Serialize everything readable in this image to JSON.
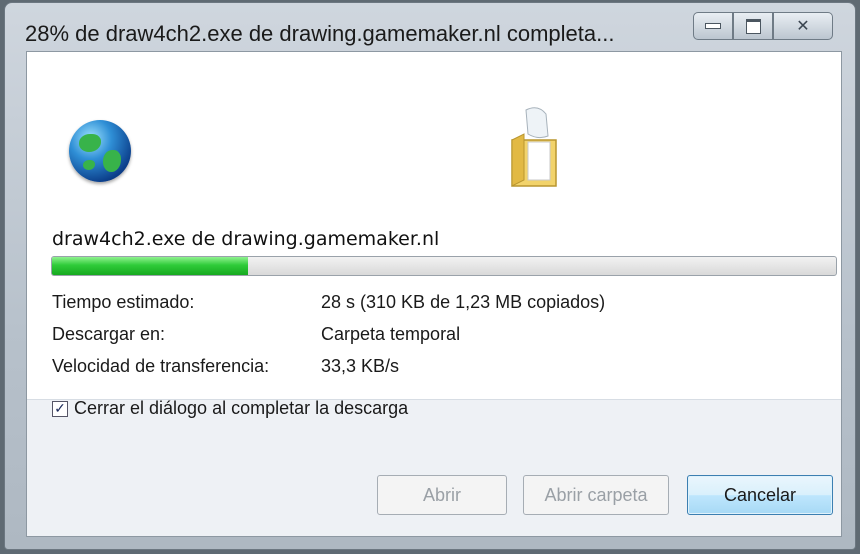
{
  "window": {
    "title": "28% de draw4ch2.exe de drawing.gamemaker.nl completa...",
    "controls": {
      "minimize_icon": "minimize-icon",
      "maximize_icon": "maximize-icon",
      "close_glyph": "✕"
    }
  },
  "download": {
    "file_line": "draw4ch2.exe de drawing.gamemaker.nl",
    "progress_fraction": 0.25
  },
  "details": {
    "time_label": "Tiempo estimado:",
    "time_value": "28 s (310 KB de 1,23 MB copiados)",
    "dest_label": "Descargar en:",
    "dest_value": "Carpeta temporal",
    "speed_label": "Velocidad de transferencia:",
    "speed_value": "33,3 KB/s"
  },
  "options": {
    "close_checkbox_checked": true,
    "check_glyph": "✓",
    "close_checkbox_label": "Cerrar el diálogo al completar la descarga"
  },
  "buttons": {
    "open": "Abrir",
    "open_folder": "Abrir carpeta",
    "cancel": "Cancelar"
  },
  "icons": {
    "source": "globe-icon",
    "destination": "folder-icon"
  },
  "colors": {
    "progress": "#2fcb39",
    "accent_button": "#3c7fb1"
  }
}
